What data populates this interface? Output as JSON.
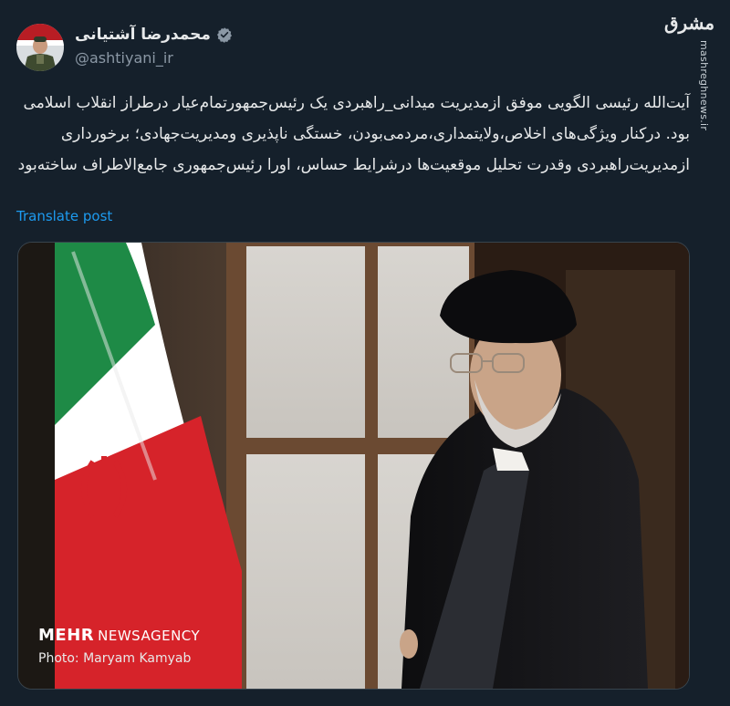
{
  "author": {
    "display_name": "محمدرضا آشتیانی",
    "handle": "@ashtiyani_ir",
    "verified": true
  },
  "watermark": {
    "logo_text": "مشرق",
    "url": "mashreghnews.ir"
  },
  "tweet": {
    "text": "آیت‌الله رئیسی الگویی موفق ازمدیریت میدانی_راهبردی یک رئیس‌جمهورتمام‌عیار درطراز انقلاب اسلامی بود. درکنار ویژگی‌های اخلاص،ولایتمداری،مردمی‌بودن، خستگی ناپذیری ومدیریت‌جهادی؛ برخورداری ازمدیریت‌راهبردی وقدرت تحلیل موقعیت‌ها درشرایط حساس، اورا رئیس‌جمهوری جامع‌الاطراف ساخته‌بود",
    "translate_label": "Translate post"
  },
  "media": {
    "agency_bold": "MEHR",
    "agency_rest": "NEWSAGENCY",
    "photo_credit": "Photo: Maryam Kamyab"
  },
  "colors": {
    "background": "#15202b",
    "link": "#1d9bf0",
    "verified": "#8b98a5"
  }
}
